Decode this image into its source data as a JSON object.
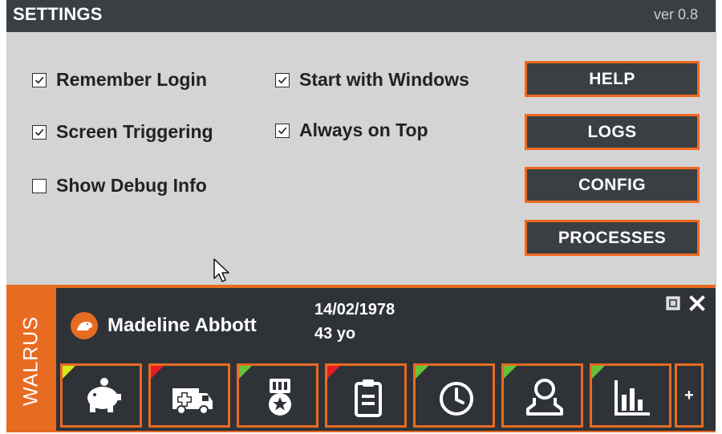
{
  "settings": {
    "title": "SETTINGS",
    "version": "ver 0.8",
    "checkboxes": [
      {
        "label": "Remember Login",
        "checked": true
      },
      {
        "label": "Screen Triggering",
        "checked": true
      },
      {
        "label": "Show Debug Info",
        "checked": false
      },
      {
        "label": "Start with Windows",
        "checked": true
      },
      {
        "label": "Always on Top",
        "checked": true
      }
    ],
    "buttons": [
      "HELP",
      "LOGS",
      "CONFIG",
      "PROCESSES"
    ]
  },
  "widget": {
    "brand": "WALRUS",
    "patient": {
      "name": "Madeline Abbott",
      "dob": "14/02/1978",
      "age": "43 yo"
    },
    "controls": {
      "screenshot_icon": "screenshot-icon",
      "close_icon": "close-icon"
    },
    "tiles": [
      {
        "icon": "piggy-bank-icon",
        "status": "yellow"
      },
      {
        "icon": "ambulance-icon",
        "status": "red"
      },
      {
        "icon": "medal-icon",
        "status": "green"
      },
      {
        "icon": "clipboard-icon",
        "status": "red"
      },
      {
        "icon": "clock-icon",
        "status": "green"
      },
      {
        "icon": "user-icon",
        "status": "green"
      },
      {
        "icon": "bar-chart-icon",
        "status": "green"
      }
    ],
    "more_label": "+"
  },
  "colors": {
    "accent": "#e86b22",
    "header_bg": "#3a3f44",
    "panel_bg": "#d4d4d4",
    "status_yellow": "#d8e81c",
    "status_red": "#e81c24",
    "status_green": "#66c23a"
  }
}
